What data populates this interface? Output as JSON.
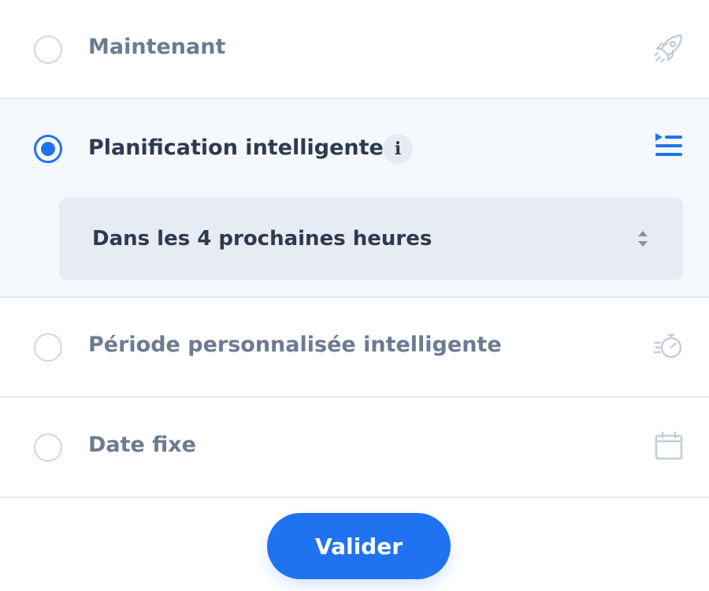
{
  "options": [
    {
      "label": "Maintenant",
      "selected": false,
      "icon": "rocket-icon"
    },
    {
      "label": "Planification intelligente",
      "selected": true,
      "icon": "queue-list-icon",
      "info_icon": "i",
      "select": {
        "value": "Dans les 4 prochaines heures"
      }
    },
    {
      "label": "Période personnalisée intelligente",
      "selected": false,
      "icon": "fast-timer-icon"
    },
    {
      "label": "Date fixe",
      "selected": false,
      "icon": "calendar-icon"
    }
  ],
  "submit": {
    "label": "Valider"
  },
  "colors": {
    "accent": "#1f73f1",
    "muted_text": "#6c7b93",
    "active_text": "#2d3a4f",
    "divider": "#e4e9f0"
  }
}
